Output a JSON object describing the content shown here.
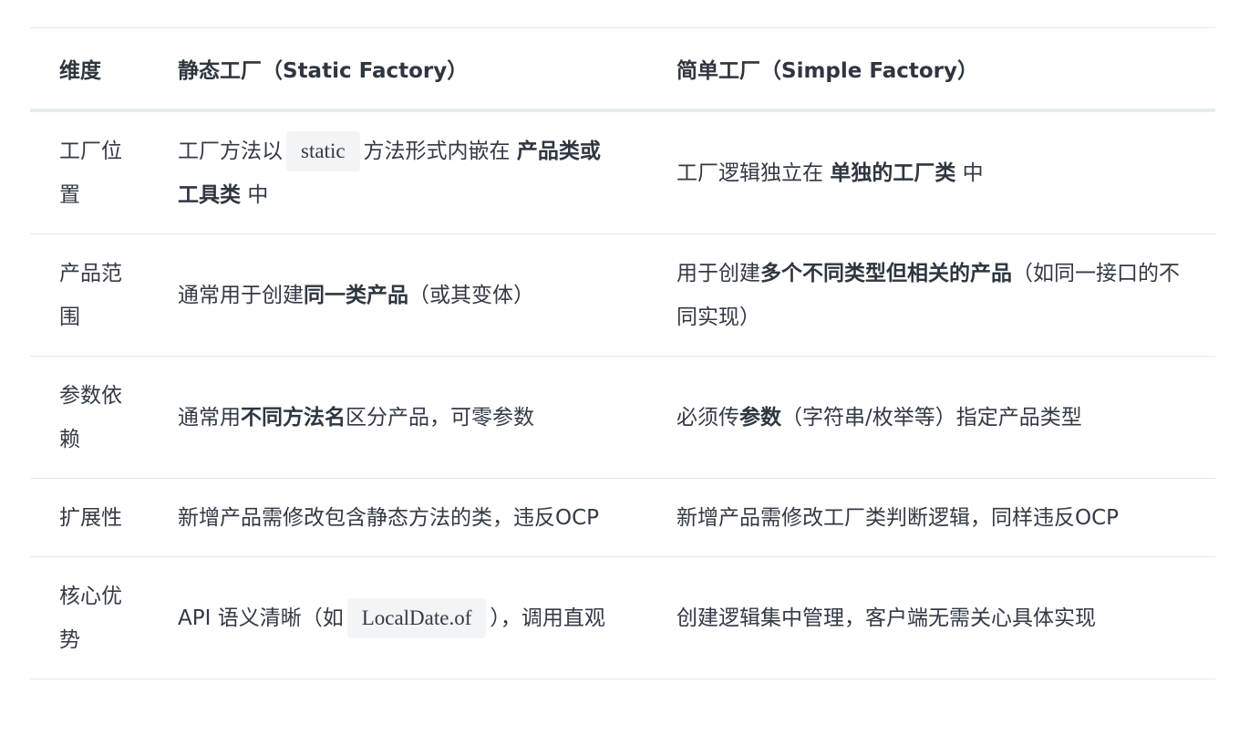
{
  "table": {
    "headers": [
      "维度",
      "静态工厂（Static Factory）",
      "简单工厂（Simple Factory）"
    ],
    "rows": [
      {
        "dimension": "工厂位置",
        "static": {
          "t1": "工厂方法以",
          "code": "static",
          "t2": "方法形式内嵌在",
          "b1": "产品类或工具类",
          "t3": "中"
        },
        "simple": {
          "t1": "工厂逻辑独立在",
          "b1": "单独的工厂类",
          "t2": "中"
        }
      },
      {
        "dimension": "产品范围",
        "static": {
          "t1": "通常用于创建",
          "b1": "同一类产品",
          "t2": "（或其变体）"
        },
        "simple": {
          "t1": "用于创建",
          "b1": "多个不同类型但相关的产品",
          "t2": "（如同一接口的不同实现）"
        }
      },
      {
        "dimension": "参数依赖",
        "static": {
          "t1": "通常用",
          "b1": "不同方法名",
          "t2": "区分产品，可零参数"
        },
        "simple": {
          "t1": "必须传",
          "b1": "参数",
          "t2": "（字符串/枚举等）指定产品类型"
        }
      },
      {
        "dimension": "扩展性",
        "static": {
          "t1": "新增产品需修改包含静态方法的类，违反OCP"
        },
        "simple": {
          "t1": "新增产品需修改工厂类判断逻辑，同样违反OCP"
        }
      },
      {
        "dimension": "核心优势",
        "static": {
          "t1": "API 语义清晰（如",
          "code": "LocalDate.of",
          "t2": "），调用直观"
        },
        "simple": {
          "t1": "创建逻辑集中管理，客户端无需关心具体实现"
        }
      }
    ]
  }
}
